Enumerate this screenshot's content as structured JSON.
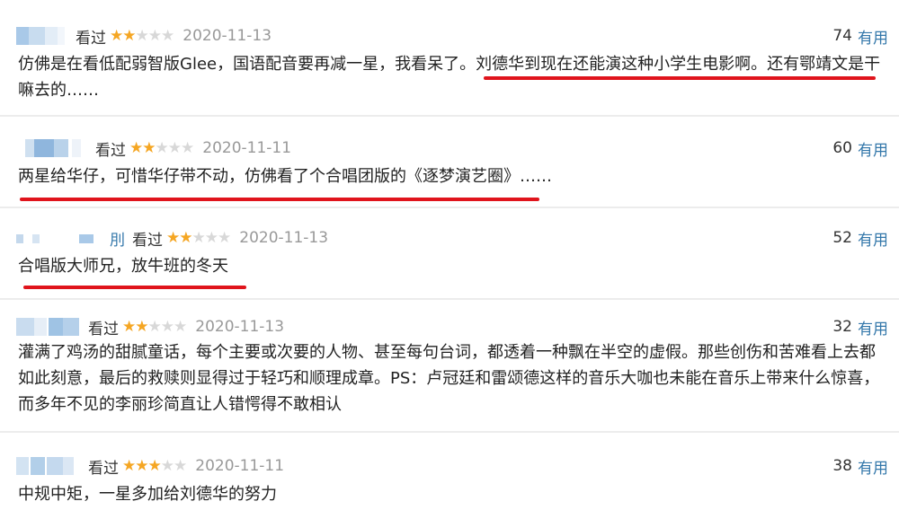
{
  "reviews": [
    {
      "status": "看过",
      "rating": 2,
      "date": "2020-11-13",
      "votes": "74",
      "useful_label": "有用",
      "text": "仿佛是在看低配弱智版Glee，国语配音要再减一星，我看呆了。刘德华到现在还能演这种小学生电影啊。还有鄂靖文是干嘛去的……"
    },
    {
      "status": "看过",
      "rating": 2,
      "date": "2020-11-11",
      "votes": "60",
      "useful_label": "有用",
      "text": "两星给华仔，可惜华仔带不动，仿佛看了个合唱团版的《逐梦演艺圈》……"
    },
    {
      "user_fragment": "刖",
      "status": "看过",
      "rating": 2,
      "date": "2020-11-13",
      "votes": "52",
      "useful_label": "有用",
      "text": "合唱版大师兄，放牛班的冬天"
    },
    {
      "status": "看过",
      "rating": 2,
      "date": "2020-11-13",
      "votes": "32",
      "useful_label": "有用",
      "text": "灌满了鸡汤的甜腻童话，每个主要或次要的人物、甚至每句台词，都透着一种飘在半空的虚假。那些创伤和苦难看上去都如此刻意，最后的救赎则显得过于轻巧和顺理成章。PS：卢冠廷和雷颂德这样的音乐大咖也未能在音乐上带来什么惊喜，而多年不见的李丽珍简直让人错愕得不敢相认"
    },
    {
      "status": "看过",
      "rating": 3,
      "date": "2020-11-11",
      "votes": "38",
      "useful_label": "有用",
      "text": "中规中矩，一星多加给刘德华的努力"
    }
  ],
  "colors": {
    "star_on": "#f5a623",
    "star_off": "#d8d8d8",
    "useful_link": "#3377aa",
    "highlight_underline": "#e0141c"
  },
  "icons": {
    "star_filled": "★",
    "star_empty": "★"
  }
}
